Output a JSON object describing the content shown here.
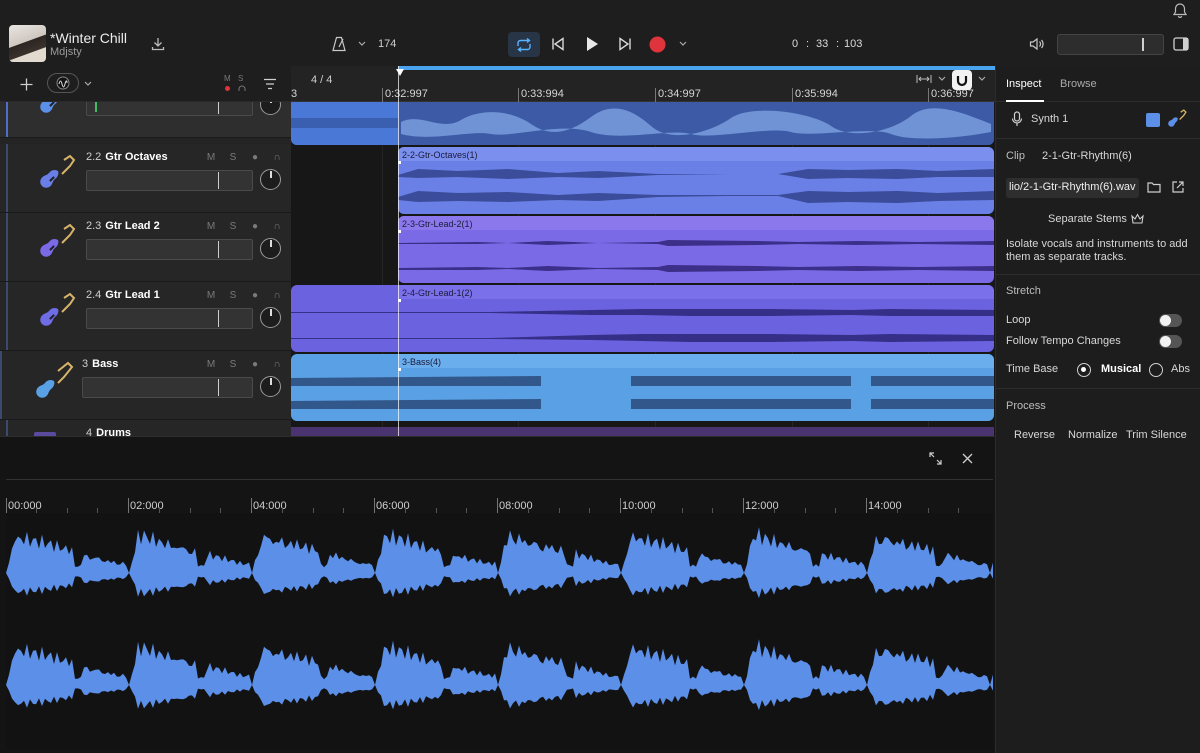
{
  "project": {
    "title": "*Winter Chill",
    "user": "Mdjsty"
  },
  "transport": {
    "tempo": "174",
    "time_min": "0",
    "time_sep1": ":",
    "time_sec": "33",
    "time_sep2": ":",
    "time_ms": "103"
  },
  "colors": {
    "accent_blue": "#4aa3ef",
    "record_red": "#e0343c",
    "clip_blue": "#5b8fe8",
    "clip_purple": "#7a6ae6",
    "clip_bass": "#5aa0e4"
  },
  "tracks": [
    {
      "num": "",
      "name": ""
    },
    {
      "num": "2.2",
      "name": "Gtr Octaves"
    },
    {
      "num": "2.3",
      "name": "Gtr Lead 2"
    },
    {
      "num": "2.4",
      "name": "Gtr Lead 1"
    },
    {
      "num": "3",
      "name": "Bass"
    },
    {
      "num": "4",
      "name": "Drums"
    }
  ],
  "track_buttons": {
    "mute": "M",
    "solo": "S"
  },
  "header_mini": {
    "m": "M",
    "s": "S"
  },
  "ruler": {
    "signature": "4 / 4",
    "start_fragment": "3",
    "labels": [
      "0:32:997",
      "0:33:994",
      "0:34:997",
      "0:35:994",
      "0:36:997"
    ]
  },
  "clips": [
    {
      "label": ""
    },
    {
      "label": "2-2-Gtr-Octaves(1)"
    },
    {
      "label": "2-3-Gtr-Lead-2(1)"
    },
    {
      "label": "2-4-Gtr-Lead-1(2)"
    },
    {
      "label": "3-Bass(4)"
    }
  ],
  "inspector": {
    "tab_inspect": "Inspect",
    "tab_browse": "Browse",
    "instrument": "Synth 1",
    "clip_label": "Clip",
    "clip_name": "2-1-Gtr-Rhythm(6)",
    "file_path": "lio/2-1-Gtr-Rhythm(6).wav",
    "separate_stems": "Separate Stems",
    "stems_desc": "Isolate vocals and instruments to add them as separate tracks.",
    "stretch": "Stretch",
    "loop": "Loop",
    "follow_tempo": "Follow Tempo Changes",
    "time_base": "Time Base",
    "musical": "Musical",
    "absolute": "Abs",
    "process": "Process",
    "reverse": "Reverse",
    "normalize": "Normalize",
    "trim_silence": "Trim Silence"
  },
  "editor": {
    "labels": [
      "00:000",
      "02:000",
      "04:000",
      "06:000",
      "08:000",
      "10:000",
      "12:000",
      "14:000"
    ]
  }
}
